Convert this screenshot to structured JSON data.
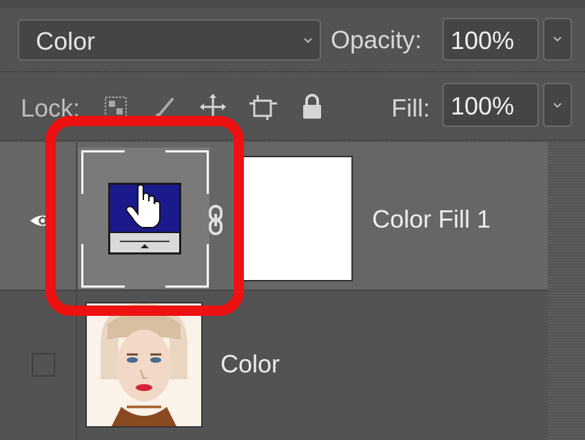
{
  "blend_mode": {
    "value": "Color"
  },
  "opacity": {
    "label": "Opacity:",
    "value": "100%"
  },
  "lock": {
    "label": "Lock:",
    "icons": [
      "lock-transparent-pixels-icon",
      "lock-image-pixels-icon",
      "lock-position-icon",
      "lock-artboard-icon",
      "lock-all-icon"
    ]
  },
  "fill": {
    "label": "Fill:",
    "value": "100%"
  },
  "layers": [
    {
      "name": "Color Fill 1",
      "visible": true,
      "selected": true,
      "thumbnail_icon": "adjustment-layer-computer-hand-icon",
      "mask_color": "#ffffff"
    },
    {
      "name": "Color",
      "visible": false,
      "selected": false,
      "thumbnail_icon": "photo-portrait-thumbnail"
    }
  ],
  "colors": {
    "panel_bg": "#535353",
    "selected_row_bg": "#666666",
    "highlight_ring": "#ee1111",
    "monitor_screen": "#1a1a8c"
  }
}
